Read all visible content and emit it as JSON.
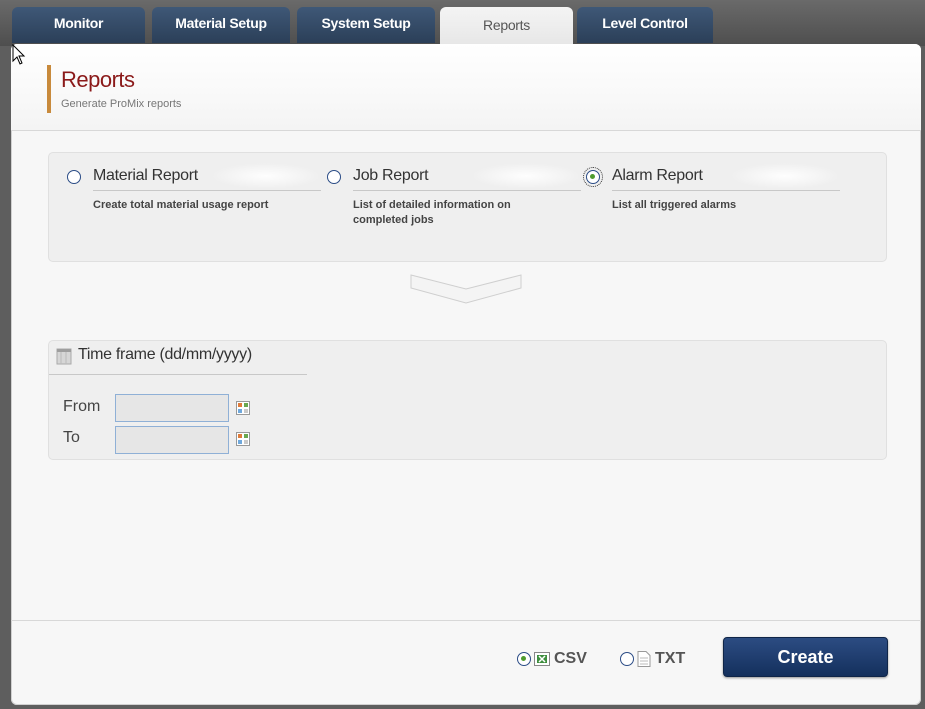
{
  "tabs": [
    {
      "label": "Monitor",
      "active": false
    },
    {
      "label": "Material Setup",
      "active": false
    },
    {
      "label": "System Setup",
      "active": false
    },
    {
      "label": "Reports",
      "active": true
    },
    {
      "label": "Level Control",
      "active": false
    }
  ],
  "header": {
    "title": "Reports",
    "subtitle": "Generate ProMix reports"
  },
  "report_types": [
    {
      "label": "Material Report",
      "description": "Create total material usage report",
      "selected": false
    },
    {
      "label": "Job Report",
      "description": "List of detailed information on completed jobs",
      "selected": false
    },
    {
      "label": "Alarm Report",
      "description": "List all triggered alarms",
      "selected": true
    }
  ],
  "timeframe": {
    "title": "Time frame (dd/mm/yyyy)",
    "from_label": "From",
    "from_value": "",
    "to_label": "To",
    "to_value": ""
  },
  "formats": [
    {
      "label": "CSV",
      "selected": true,
      "icon": "spreadsheet-icon"
    },
    {
      "label": "TXT",
      "selected": false,
      "icon": "text-file-icon"
    }
  ],
  "create_label": "Create",
  "colors": {
    "accent": "#c88a3c",
    "title": "#8b1a1a",
    "tab": "#2b3f58",
    "button": "#14305d"
  }
}
